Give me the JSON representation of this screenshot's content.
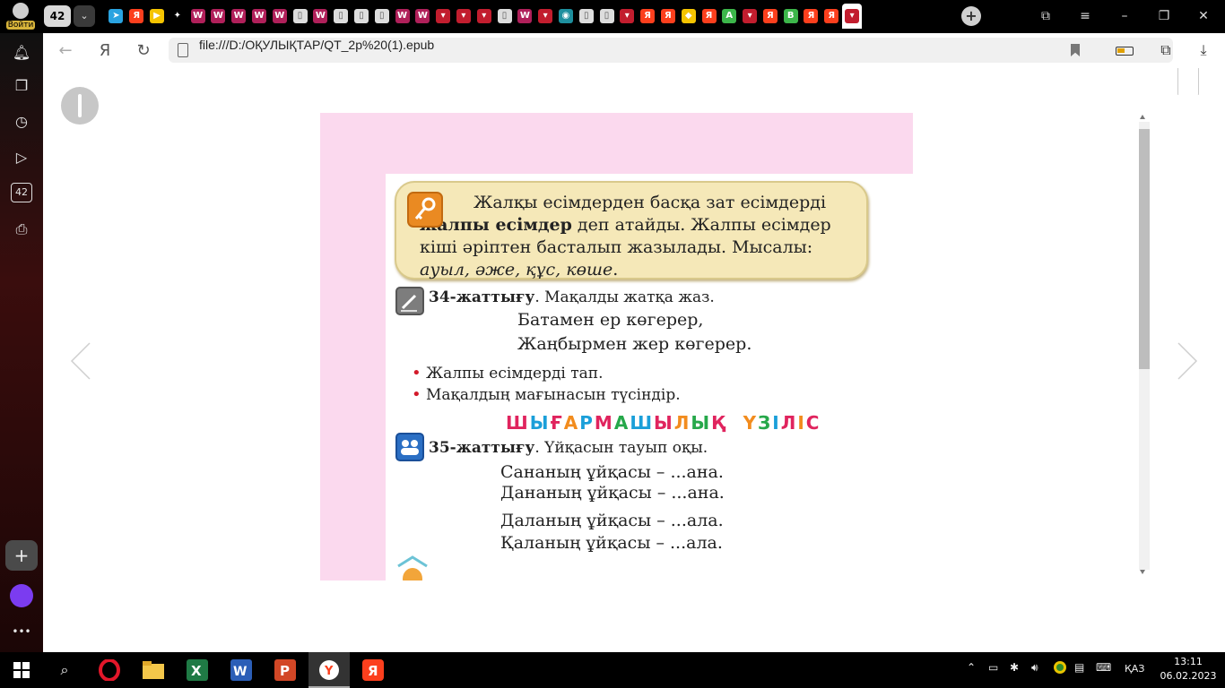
{
  "browser": {
    "login_label": "Войти",
    "tab_count": "42",
    "url": "file:///D:/ОҚУЛЫҚТАР/QT_2p%20(1).epub",
    "tabs": [
      {
        "icon": "telegram-icon",
        "color": "#2aa3e0",
        "glyph": "➤"
      },
      {
        "icon": "yandex-icon",
        "color": "#fc3f1d",
        "glyph": "Я"
      },
      {
        "icon": "play-icon",
        "color": "#f5c400",
        "glyph": "▶"
      },
      {
        "icon": "sparkle-icon",
        "color": "#000000",
        "glyph": "✦"
      },
      {
        "icon": "document-icon",
        "color": "#b0205a",
        "glyph": "W"
      },
      {
        "icon": "document-icon",
        "color": "#b0205a",
        "glyph": "W"
      },
      {
        "icon": "document-icon",
        "color": "#b0205a",
        "glyph": "W"
      },
      {
        "icon": "document-icon",
        "color": "#b0205a",
        "glyph": "W"
      },
      {
        "icon": "document-icon",
        "color": "#b0205a",
        "glyph": "W"
      },
      {
        "icon": "file-icon",
        "color": "#dddddd",
        "glyph": "▯"
      },
      {
        "icon": "document-icon",
        "color": "#b0205a",
        "glyph": "W"
      },
      {
        "icon": "file-icon",
        "color": "#dddddd",
        "glyph": "▯"
      },
      {
        "icon": "file-icon",
        "color": "#dddddd",
        "glyph": "▯"
      },
      {
        "icon": "file-icon",
        "color": "#dddddd",
        "glyph": "▯"
      },
      {
        "icon": "document-icon",
        "color": "#b0205a",
        "glyph": "W"
      },
      {
        "icon": "document-icon",
        "color": "#b0205a",
        "glyph": "W"
      },
      {
        "icon": "shield-icon",
        "color": "#c21d2e",
        "glyph": "▾"
      },
      {
        "icon": "shield-icon",
        "color": "#c21d2e",
        "glyph": "▾"
      },
      {
        "icon": "shield-icon",
        "color": "#c21d2e",
        "glyph": "▾"
      },
      {
        "icon": "file-icon",
        "color": "#dddddd",
        "glyph": "▯"
      },
      {
        "icon": "document-icon",
        "color": "#b0205a",
        "glyph": "W"
      },
      {
        "icon": "shield-icon",
        "color": "#c21d2e",
        "glyph": "▾"
      },
      {
        "icon": "globe-icon",
        "color": "#1e8f9e",
        "glyph": "◉"
      },
      {
        "icon": "file-icon",
        "color": "#dddddd",
        "glyph": "▯"
      },
      {
        "icon": "file-icon",
        "color": "#dddddd",
        "glyph": "▯"
      },
      {
        "icon": "shield-icon",
        "color": "#c21d2e",
        "glyph": "▾"
      },
      {
        "icon": "yandex-icon",
        "color": "#fc3f1d",
        "glyph": "Я"
      },
      {
        "icon": "yandex-icon",
        "color": "#fc3f1d",
        "glyph": "Я"
      },
      {
        "icon": "maps-icon",
        "color": "#f5c400",
        "glyph": "◆"
      },
      {
        "icon": "yandex-icon",
        "color": "#fc3f1d",
        "glyph": "Я"
      },
      {
        "icon": "green-a-icon",
        "color": "#3cb64a",
        "glyph": "A"
      },
      {
        "icon": "shield-icon",
        "color": "#c21d2e",
        "glyph": "▾"
      },
      {
        "icon": "yandex-icon",
        "color": "#fc3f1d",
        "glyph": "Я"
      },
      {
        "icon": "green-b-icon",
        "color": "#3cb64a",
        "glyph": "B"
      },
      {
        "icon": "yandex-icon",
        "color": "#fc3f1d",
        "glyph": "Я"
      },
      {
        "icon": "yandex-icon",
        "color": "#fc3f1d",
        "glyph": "Я"
      },
      {
        "icon": "shield-icon",
        "color": "#c21d2e",
        "glyph": "▾",
        "active": true
      }
    ]
  },
  "sidebar": {
    "items": [
      {
        "name": "bell-icon",
        "glyph": "🔔︎"
      },
      {
        "name": "collections-icon",
        "glyph": "❐"
      },
      {
        "name": "history-icon",
        "glyph": "◷"
      },
      {
        "name": "video-icon",
        "glyph": "▷"
      },
      {
        "name": "tabs-count-icon",
        "glyph": "42"
      },
      {
        "name": "screenshot-icon",
        "glyph": "⎙"
      }
    ],
    "plus_glyph": "+",
    "more_glyph": "•••"
  },
  "page": {
    "rule_line1": "Жалқы есімдерден басқа зат есімдерді",
    "rule_bold": "жалпы есімдер",
    "rule_line2_rest": " деп атайды. Жалпы есімдер",
    "rule_line3": "кіші әріптен басталып жазылады. Мысалы:",
    "rule_example": "ауыл, әже, құс, көше",
    "rule_example_end": ".",
    "ex34_num": "34-жаттығу",
    "ex34_text": ". Мақалды жатқа жаз.",
    "proverb1": "Батамен ер көгерер,",
    "proverb2": "Жаңбырмен жер көгерер.",
    "bullet1": "Жалпы есімдерді тап.",
    "bullet2": "Мақалдың мағынасын түсіндір.",
    "pause_letters": [
      {
        "ch": "Ш",
        "color": "#e0245e"
      },
      {
        "ch": "Ы",
        "color": "#1a9fd9"
      },
      {
        "ch": "Ғ",
        "color": "#e0245e"
      },
      {
        "ch": "А",
        "color": "#f28c1e"
      },
      {
        "ch": "Р",
        "color": "#1a9fd9"
      },
      {
        "ch": "М",
        "color": "#e0245e"
      },
      {
        "ch": "А",
        "color": "#26a84a"
      },
      {
        "ch": "Ш",
        "color": "#1a9fd9"
      },
      {
        "ch": "Ы",
        "color": "#e0245e"
      },
      {
        "ch": "Л",
        "color": "#f28c1e"
      },
      {
        "ch": "Ы",
        "color": "#26a84a"
      },
      {
        "ch": "Қ",
        "color": "#e0245e"
      },
      {
        "ch": " ",
        "color": "#000000"
      },
      {
        "ch": "Ү",
        "color": "#f28c1e"
      },
      {
        "ch": "З",
        "color": "#26a84a"
      },
      {
        "ch": "І",
        "color": "#1a9fd9"
      },
      {
        "ch": "Л",
        "color": "#e0245e"
      },
      {
        "ch": "І",
        "color": "#f28c1e"
      },
      {
        "ch": "С",
        "color": "#e0245e"
      }
    ],
    "ex35_num": "35-жаттығу",
    "ex35_text": ". Үйқасын тауып оқы.",
    "rhyme1": "Сананың ұйқасы – ...ана.",
    "rhyme2": "Дананың ұйқасы – ...ана.",
    "rhyme3": "Даланың ұйқасы – ...ала.",
    "rhyme4": "Қаланың ұйқасы – ...ала."
  },
  "taskbar": {
    "lang": "ҚАЗ",
    "time": "13:11",
    "date": "06.02.2023"
  },
  "colors": {
    "page_pink": "#fbd9ee",
    "rule_box": "#f5e8b8",
    "accent_orange": "#ea8a22"
  }
}
